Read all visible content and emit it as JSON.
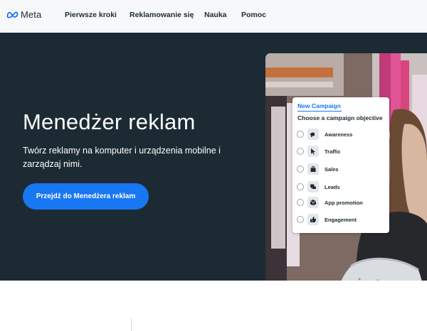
{
  "brand": {
    "name": "Meta",
    "logo_icon": "meta-infinity-icon",
    "color": "#0866ff"
  },
  "nav": {
    "items": [
      {
        "label": "Pierwsze kroki"
      },
      {
        "label": "Reklamowanie się"
      },
      {
        "label": "Nauka"
      },
      {
        "label": "Pomoc"
      }
    ]
  },
  "hero": {
    "title": "Menedżer reklam",
    "subtitle": "Twórz reklamy na komputer i urządzenia mobilne i zarządzaj nimi.",
    "cta_label": "Przejdź do Menedżera reklam",
    "background": "#1c2b33",
    "cta_color": "#1877f2"
  },
  "campaign_card": {
    "tab_label": "New Campaign",
    "heading": "Choose a campaign objective",
    "objectives": [
      {
        "label": "Awareness",
        "icon": "megaphone-icon"
      },
      {
        "label": "Traffic",
        "icon": "cursor-icon"
      },
      {
        "label": "Sales",
        "icon": "shopping-bag-icon"
      },
      {
        "label": "Leads",
        "icon": "chat-bubbles-icon"
      },
      {
        "label": "App promotion",
        "icon": "cube-icon"
      },
      {
        "label": "Engagement",
        "icon": "thumbs-up-icon"
      }
    ]
  }
}
